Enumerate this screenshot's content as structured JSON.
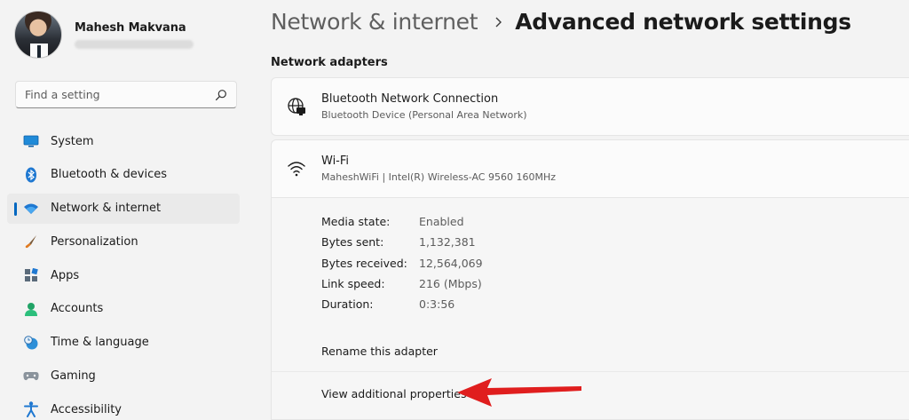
{
  "profile": {
    "name": "Mahesh Makvana"
  },
  "search": {
    "placeholder": "Find a setting"
  },
  "sidebar": {
    "items": [
      {
        "label": "System",
        "icon": "system-icon"
      },
      {
        "label": "Bluetooth & devices",
        "icon": "bluetooth-icon"
      },
      {
        "label": "Network & internet",
        "icon": "wifi-icon",
        "selected": true
      },
      {
        "label": "Personalization",
        "icon": "brush-icon"
      },
      {
        "label": "Apps",
        "icon": "apps-icon"
      },
      {
        "label": "Accounts",
        "icon": "accounts-icon"
      },
      {
        "label": "Time & language",
        "icon": "clock-globe-icon"
      },
      {
        "label": "Gaming",
        "icon": "gamepad-icon"
      },
      {
        "label": "Accessibility",
        "icon": "accessibility-icon"
      }
    ]
  },
  "header": {
    "parent": "Network & internet",
    "current": "Advanced network settings"
  },
  "main": {
    "section_title": "Network adapters",
    "adapters": [
      {
        "title": "Bluetooth Network Connection",
        "subtitle": "Bluetooth Device (Personal Area Network)",
        "icon": "network-globe-icon"
      },
      {
        "title": "Wi-Fi",
        "subtitle": "MaheshWiFi | Intel(R) Wireless-AC 9560 160MHz",
        "icon": "wifi-icon"
      }
    ],
    "properties": [
      {
        "key": "Media state:",
        "value": "Enabled"
      },
      {
        "key": "Bytes sent:",
        "value": "1,132,381"
      },
      {
        "key": "Bytes received:",
        "value": "12,564,069"
      },
      {
        "key": "Link speed:",
        "value": "216 (Mbps)"
      },
      {
        "key": "Duration:",
        "value": "0:3:56"
      }
    ],
    "actions": {
      "rename": "Rename this adapter",
      "view": "View additional properties"
    }
  },
  "colors": {
    "accent": "#0067c0",
    "annotation_arrow": "#e01e1e",
    "background": "#f3f3f3"
  }
}
